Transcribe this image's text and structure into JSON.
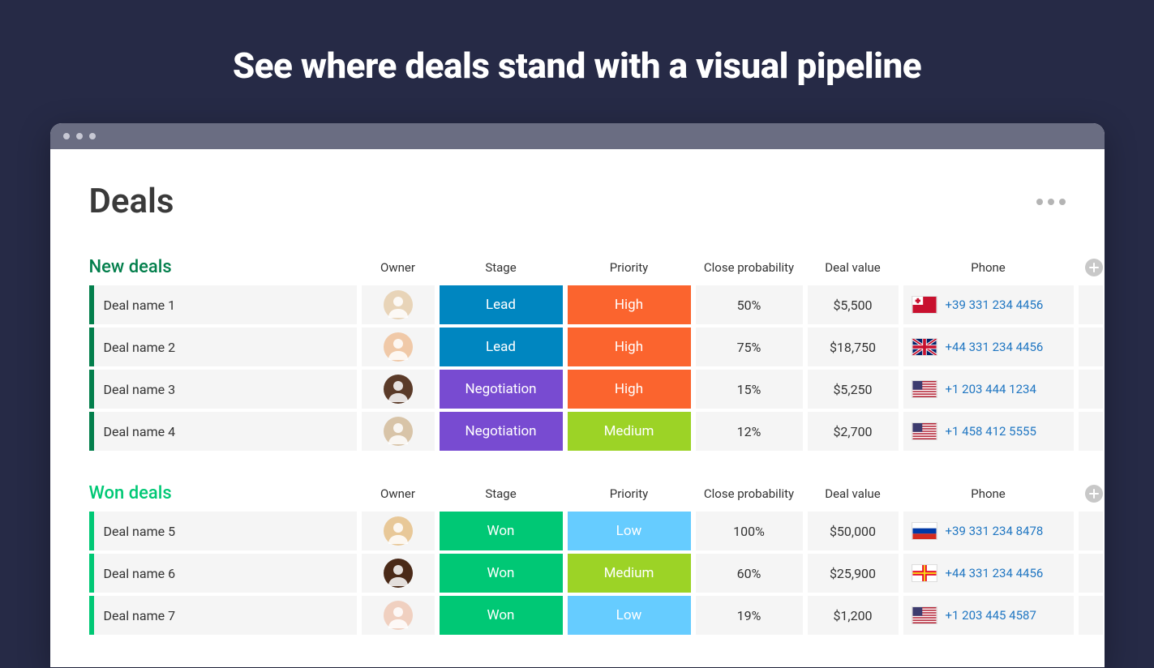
{
  "hero_title": "See where deals stand with a visual pipeline",
  "page_title": "Deals",
  "columns": {
    "owner": "Owner",
    "stage": "Stage",
    "priority": "Priority",
    "close_prob": "Close probability",
    "deal_value": "Deal value",
    "phone": "Phone"
  },
  "groups": {
    "new": {
      "title": "New deals",
      "rows": [
        {
          "name": "Deal name 1",
          "avatar_bg": "#e8d4b8",
          "stage": "Lead",
          "stage_class": "stage-lead",
          "priority": "High",
          "priority_class": "prio-high",
          "close_prob": "50%",
          "deal_value": "$5,500",
          "flag": "tonga",
          "phone": "+39 331 234 4456"
        },
        {
          "name": "Deal name 2",
          "avatar_bg": "#f0c9a8",
          "stage": "Lead",
          "stage_class": "stage-lead",
          "priority": "High",
          "priority_class": "prio-high",
          "close_prob": "75%",
          "deal_value": "$18,750",
          "flag": "uk",
          "phone": "+44 331 234 4456"
        },
        {
          "name": "Deal name 3",
          "avatar_bg": "#5a3a28",
          "stage": "Negotiation",
          "stage_class": "stage-negotiation",
          "priority": "High",
          "priority_class": "prio-high",
          "close_prob": "15%",
          "deal_value": "$5,250",
          "flag": "us",
          "phone": "+1 203 444 1234"
        },
        {
          "name": "Deal name 4",
          "avatar_bg": "#d8c4a8",
          "stage": "Negotiation",
          "stage_class": "stage-negotiation",
          "priority": "Medium",
          "priority_class": "prio-medium",
          "close_prob": "12%",
          "deal_value": "$2,700",
          "flag": "us",
          "phone": "+1 458 412 5555"
        }
      ]
    },
    "won": {
      "title": "Won deals",
      "rows": [
        {
          "name": "Deal name 5",
          "avatar_bg": "#e8c898",
          "stage": "Won",
          "stage_class": "stage-won",
          "priority": "Low",
          "priority_class": "prio-low",
          "close_prob": "100%",
          "deal_value": "$50,000",
          "flag": "russia",
          "phone": "+39 331 234 8478"
        },
        {
          "name": "Deal name 6",
          "avatar_bg": "#4a2a18",
          "stage": "Won",
          "stage_class": "stage-won",
          "priority": "Medium",
          "priority_class": "prio-medium",
          "close_prob": "60%",
          "deal_value": "$25,900",
          "flag": "guernsey",
          "phone": "+44 331 234 4456"
        },
        {
          "name": "Deal name 7",
          "avatar_bg": "#f0d0c0",
          "stage": "Won",
          "stage_class": "stage-won",
          "priority": "Low",
          "priority_class": "prio-low",
          "close_prob": "19%",
          "deal_value": "$1,200",
          "flag": "us",
          "phone": "+1 203 445 4587"
        }
      ]
    }
  }
}
